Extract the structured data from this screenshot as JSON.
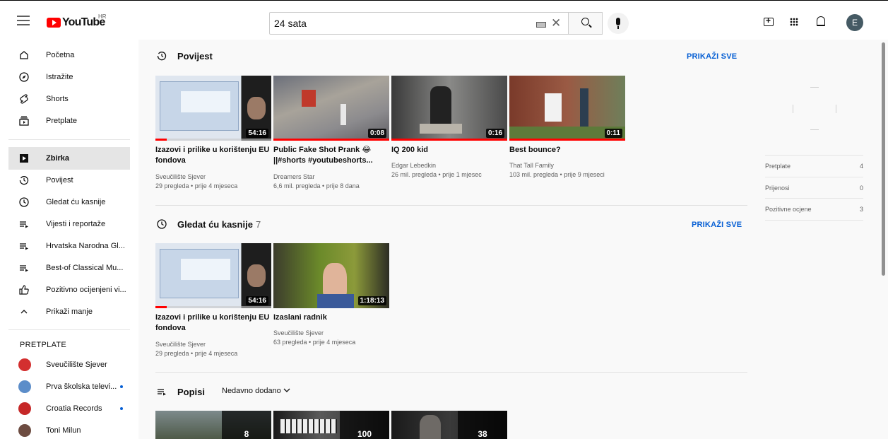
{
  "header": {
    "logo_text": "YouTube",
    "region": "HR",
    "search_value": "24 sata",
    "avatar_letter": "E"
  },
  "sidebar": {
    "main_items": [
      {
        "label": "Početna",
        "icon": "home-icon"
      },
      {
        "label": "Istražite",
        "icon": "explore-icon"
      },
      {
        "label": "Shorts",
        "icon": "shorts-icon"
      },
      {
        "label": "Pretplate",
        "icon": "subscriptions-icon"
      }
    ],
    "library_items": [
      {
        "label": "Zbirka",
        "icon": "library-icon",
        "active": true
      },
      {
        "label": "Povijest",
        "icon": "history-icon"
      },
      {
        "label": "Gledat ću kasnije",
        "icon": "watch-later-icon"
      },
      {
        "label": "Vijesti i reportaže",
        "icon": "playlist-icon"
      },
      {
        "label": "Hrvatska Narodna Gl...",
        "icon": "playlist-icon"
      },
      {
        "label": "Best-of Classical Mu...",
        "icon": "playlist-icon"
      },
      {
        "label": "Pozitivno ocijenjeni vi...",
        "icon": "like-icon"
      },
      {
        "label": "Prikaži manje",
        "icon": "chevron-up-icon"
      }
    ],
    "subscriptions_header": "PRETPLATE",
    "subscriptions": [
      {
        "label": "Sveučilište Sjever",
        "color": "#d32f2f",
        "dot": false
      },
      {
        "label": "Prva školska televi...",
        "color": "#5c8dc9",
        "dot": true
      },
      {
        "label": "Croatia Records",
        "color": "#c62828",
        "dot": true
      },
      {
        "label": "Toni Milun",
        "color": "#6d4c41",
        "dot": false
      }
    ]
  },
  "sections": {
    "history": {
      "title": "Povijest",
      "show_all": "PRIKAŽI SVE",
      "videos": [
        {
          "title": "Izazovi i prilike u korištenju EU fondova",
          "channel": "Sveučilište Sjever",
          "meta": "29 pregleda • prije 4 mjeseca",
          "duration": "54:16",
          "progress": 0.1
        },
        {
          "title": "Public Fake Shot Prank 😂 ||#shorts #youtubeshorts...",
          "channel": "Dreamers Star",
          "meta": "6,6 mil. pregleda • prije 8 dana",
          "duration": "0:08",
          "progress": 1.0
        },
        {
          "title": "IQ 200 kid",
          "channel": "Edgar Lebedkin",
          "meta": "26 mil. pregleda • prije 1 mjesec",
          "duration": "0:16",
          "progress": 1.0
        },
        {
          "title": "Best bounce?",
          "channel": "That Tall Family",
          "meta": "103 mil. pregleda • prije 9 mjeseci",
          "duration": "0:11",
          "progress": 1.0
        }
      ]
    },
    "watch_later": {
      "title": "Gledat ću kasnije",
      "count": "7",
      "show_all": "PRIKAŽI SVE",
      "videos": [
        {
          "title": "Izazovi i prilike u korištenju EU fondova",
          "channel": "Sveučilište Sjever",
          "meta": "29 pregleda • prije 4 mjeseca",
          "duration": "54:16",
          "progress": 0.1
        },
        {
          "title": "Izaslani radnik",
          "channel": "Sveučilište Sjever",
          "meta": "63 pregleda • prije 4 mjeseca",
          "duration": "1:18:13",
          "progress": 0
        }
      ]
    },
    "playlists": {
      "title": "Popisi",
      "sort_label": "Nedavno dodano",
      "items": [
        {
          "count": "8"
        },
        {
          "count": "100"
        },
        {
          "count": "38"
        }
      ]
    }
  },
  "stats": [
    {
      "label": "Pretplate",
      "value": "4"
    },
    {
      "label": "Prijenosi",
      "value": "0"
    },
    {
      "label": "Pozitivne ocjene",
      "value": "3"
    }
  ]
}
